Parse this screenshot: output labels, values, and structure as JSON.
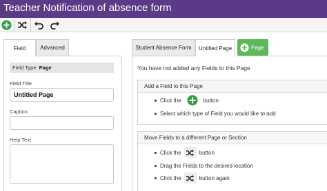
{
  "window": {
    "title": "Teacher Notification of absence form"
  },
  "toolbar": {
    "icons": [
      "add-circle-icon",
      "shuffle-icon",
      "undo-icon",
      "redo-icon"
    ],
    "accent": "#2e9e3e"
  },
  "left_panel": {
    "tabs": [
      {
        "label": "Field",
        "active": true
      },
      {
        "label": "Advanced",
        "active": false
      }
    ],
    "field_type_label": "Field Type:",
    "field_type_value": "Page",
    "field_title_label": "Field Title",
    "field_title_value": "Untitled Page",
    "caption_label": "Caption",
    "caption_value": "",
    "help_text_label": "Help Text",
    "help_text_value": ""
  },
  "right_panel": {
    "tabs": [
      {
        "label": "Student Absence Form",
        "active": false
      },
      {
        "label": "Untitled Page",
        "active": true
      }
    ],
    "add_page_label": "Page",
    "no_fields_message": "You have not added any Fields to this Page",
    "add_card": {
      "heading": "Add a Field to this Page",
      "step1_prefix": "Click the",
      "step1_suffix": "button",
      "step2": "Select which type of Field you would like to add"
    },
    "move_card": {
      "heading": "Move Fields to a different Page or Section",
      "step1_prefix": "Click the",
      "step1_suffix": "button",
      "step2": "Drag the Fields to the desired location",
      "step3_prefix": "Click the",
      "step3_suffix": "button again"
    }
  },
  "colors": {
    "title_bar": "#5b3b87",
    "add_green": "#5cb85c"
  }
}
